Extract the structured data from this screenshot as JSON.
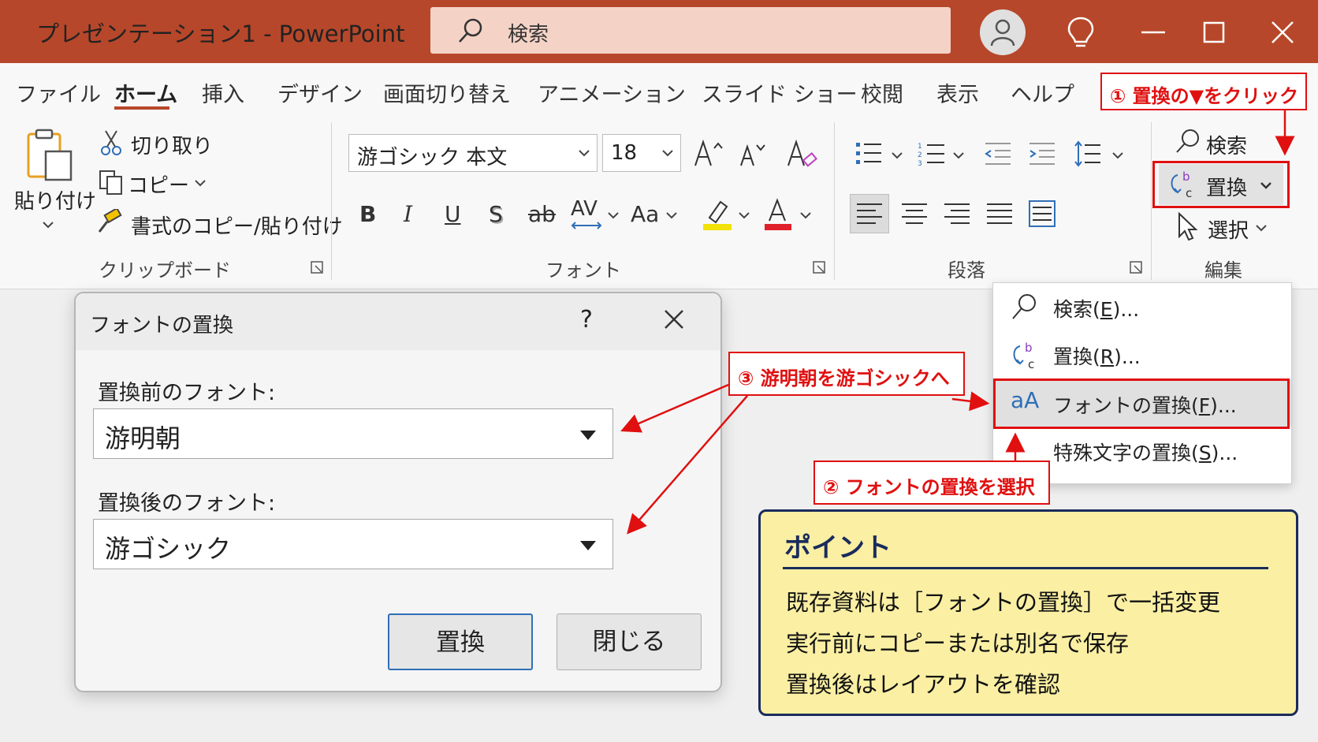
{
  "window": {
    "title": "プレゼンテーション1  -  PowerPoint",
    "search_placeholder": "検索",
    "titlebar_icons": [
      "account-icon",
      "lightbulb-icon",
      "minimize-icon",
      "maximize-icon",
      "close-icon"
    ]
  },
  "tabs": [
    "ファイル",
    "ホーム",
    "挿入",
    "デザイン",
    "画面切り替え",
    "アニメーション",
    "スライド ショー",
    "校閲",
    "表示",
    "ヘルプ"
  ],
  "active_tab": "ホーム",
  "ribbon": {
    "clipboard": {
      "paste_label": "貼り付け",
      "cut_label": "切り取り",
      "copy_label": "コピー",
      "format_painter_label": "書式のコピー/貼り付け",
      "group_label": "クリップボード"
    },
    "font": {
      "font_name": "游ゴシック 本文",
      "font_size": "18",
      "bold": "B",
      "italic": "I",
      "underline": "U",
      "shadow": "S",
      "strike": "ab",
      "spacing": "AV",
      "case": "Aa",
      "group_label": "フォント"
    },
    "paragraph": {
      "group_label": "段落"
    },
    "editing": {
      "find_label": "検索",
      "replace_label": "置換",
      "select_label": "選択",
      "group_label": "編集"
    }
  },
  "menu": {
    "items": [
      {
        "prefix": "検索(",
        "key": "E",
        "suffix": ")..."
      },
      {
        "prefix": "置換(",
        "key": "R",
        "suffix": ")..."
      },
      {
        "prefix": "フォントの置換(",
        "key": "F",
        "suffix": ")..."
      },
      {
        "prefix": "特殊文字の置換(",
        "key": "S",
        "suffix": ")..."
      }
    ],
    "font_icon_text": "aA"
  },
  "dialog": {
    "title": "フォントの置換",
    "help": "?",
    "before_label": "置換前のフォント:",
    "before_value": "游明朝",
    "after_label": "置換後のフォント:",
    "after_value": "游ゴシック",
    "replace_button": "置換",
    "close_button": "閉じる"
  },
  "annotations": {
    "step1": "① 置換の▼をクリック",
    "step2": "② フォントの置換を選択",
    "step3": "③ 游明朝を游ゴシックへ",
    "color": "#e01010"
  },
  "point": {
    "title": "ポイント",
    "lines": [
      "既存資料は［フォントの置換］で一括変更",
      "実行前にコピーまたは別名で保存",
      "置換後はレイアウトを確認"
    ]
  },
  "colors": {
    "titlebar": "#b7472a",
    "search_bg": "#f4d3c6",
    "point_bg": "#faefa3",
    "point_border": "#1a2b5c",
    "highlight_yellow": "#f2e20a",
    "font_color_red": "#e0202a"
  }
}
